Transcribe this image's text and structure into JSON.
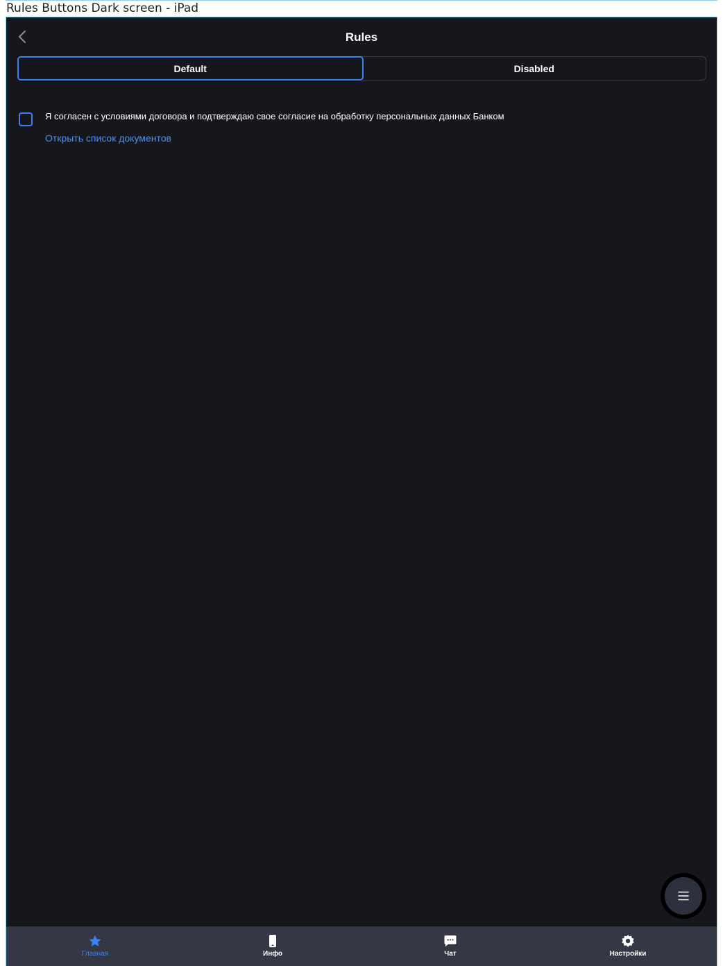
{
  "frame": {
    "title": "Rules Buttons Dark screen - iPad"
  },
  "nav": {
    "title": "Rules",
    "back_icon": "chevron-left-icon"
  },
  "segments": [
    {
      "label": "Default",
      "active": true
    },
    {
      "label": "Disabled",
      "active": false
    }
  ],
  "consent": {
    "checked": false,
    "text": "Я согласен с условиями договора и подтверждаю свое согласие на обработку персональных данных Банком",
    "link": "Открыть список документов"
  },
  "fab": {
    "icon": "menu-icon"
  },
  "tabbar": {
    "items": [
      {
        "label": "Главная",
        "icon": "star-icon",
        "active": true
      },
      {
        "label": "Инфо",
        "icon": "phone-icon",
        "active": false
      },
      {
        "label": "Чат",
        "icon": "chat-icon",
        "active": false
      },
      {
        "label": "Настройки",
        "icon": "gear-icon",
        "active": false
      }
    ]
  },
  "colors": {
    "background": "#15171d",
    "accent": "#3b82f6",
    "link": "#4a8ff5",
    "tabbar": "#343744",
    "text": "#ffffff"
  }
}
